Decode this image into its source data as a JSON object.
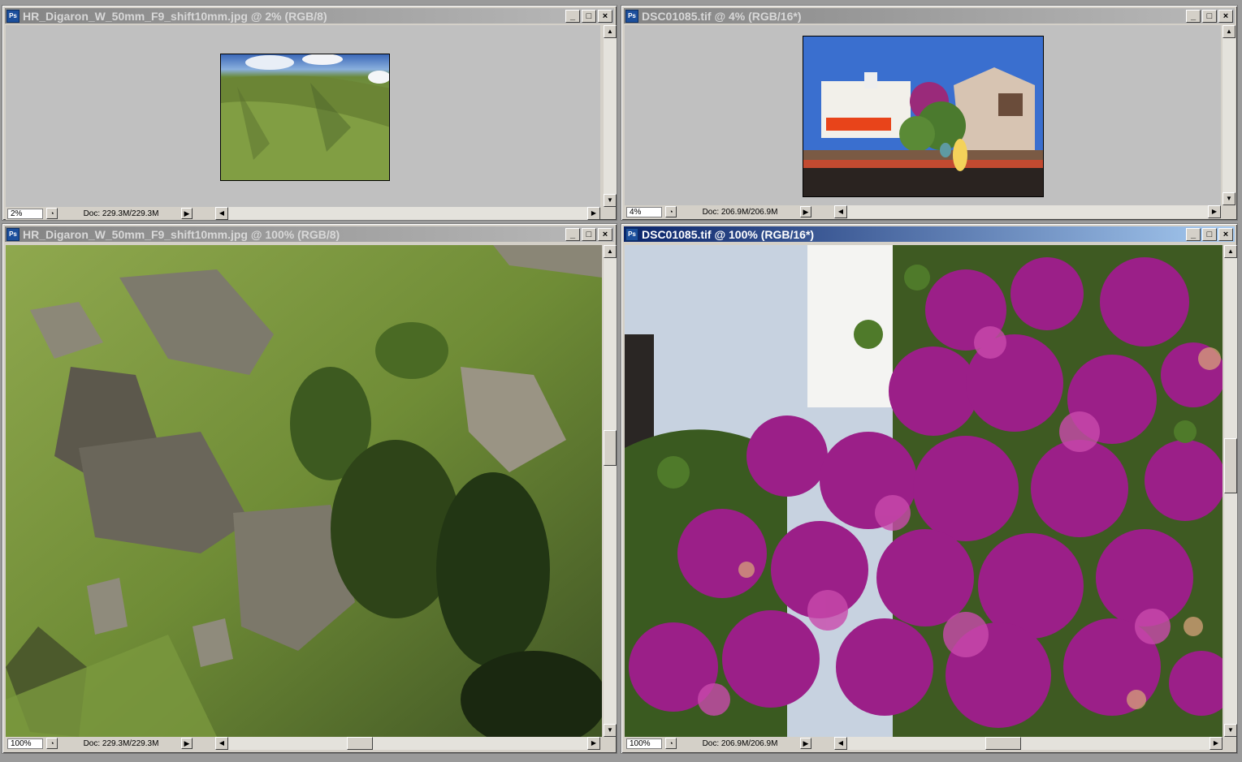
{
  "windows": [
    {
      "title": "HR_Digaron_W_50mm_F9_shift10mm.jpg @ 2% (RGB/8)",
      "zoom": "2%",
      "doc": "Doc: 229.3M/229.3M",
      "active": false
    },
    {
      "title": "DSC01085.tif @ 4% (RGB/16*)",
      "zoom": "4%",
      "doc": "Doc: 206.9M/206.9M",
      "active": false
    },
    {
      "title": "HR_Digaron_W_50mm_F9_shift10mm.jpg @ 100% (RGB/8)",
      "zoom": "100%",
      "doc": "Doc: 229.3M/229.3M",
      "active": false
    },
    {
      "title": "DSC01085.tif @ 100% (RGB/16*)",
      "zoom": "100%",
      "doc": "Doc: 206.9M/206.9M",
      "active": true
    }
  ],
  "controls": {
    "minimize": "_",
    "maximize": "□",
    "close": "×",
    "ps_icon": "Ps",
    "scroll_up": "▲",
    "scroll_down": "▼",
    "scroll_left": "◀",
    "scroll_right": "▶",
    "status_arrow": "▶",
    "status_icon": "◔"
  },
  "icons": [
    "photoshop-document-icon",
    "minimize-icon",
    "maximize-icon",
    "close-icon"
  ],
  "colors": {
    "inactive_title": "#9a9a9a",
    "active_title": "#0a246a",
    "window_face": "#d4d0c8",
    "canvas_bg": "#c0c0c0"
  }
}
